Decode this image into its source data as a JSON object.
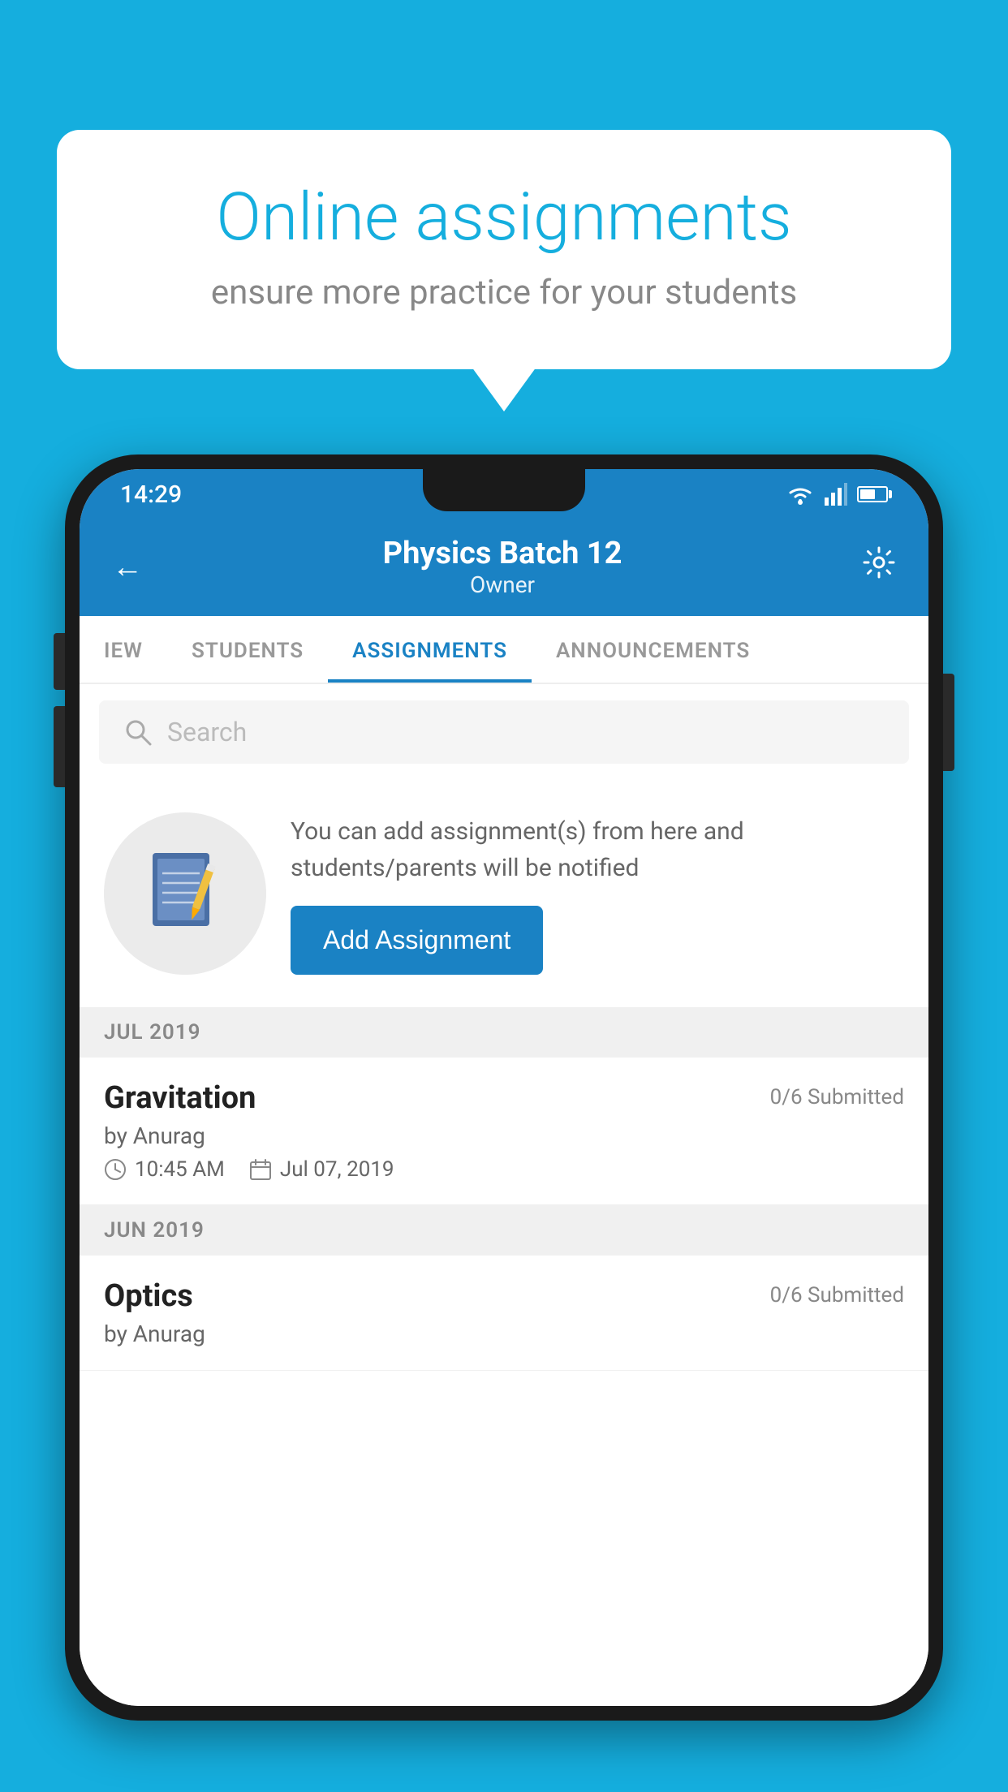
{
  "background_color": "#15AEDE",
  "speech_bubble": {
    "title": "Online assignments",
    "subtitle": "ensure more practice for your students"
  },
  "phone": {
    "status_bar": {
      "time": "14:29"
    },
    "header": {
      "title": "Physics Batch 12",
      "subtitle": "Owner",
      "back_label": "←",
      "settings_label": "⚙"
    },
    "tabs": [
      {
        "label": "IEW",
        "active": false
      },
      {
        "label": "STUDENTS",
        "active": false
      },
      {
        "label": "ASSIGNMENTS",
        "active": true
      },
      {
        "label": "ANNOUNCEMENTS",
        "active": false
      }
    ],
    "search": {
      "placeholder": "Search"
    },
    "add_assignment": {
      "description": "You can add assignment(s) from here and students/parents will be notified",
      "button_label": "Add Assignment"
    },
    "sections": [
      {
        "header": "JUL 2019",
        "items": [
          {
            "name": "Gravitation",
            "submitted": "0/6 Submitted",
            "by": "by Anurag",
            "time": "10:45 AM",
            "date": "Jul 07, 2019"
          }
        ]
      },
      {
        "header": "JUN 2019",
        "items": [
          {
            "name": "Optics",
            "submitted": "0/6 Submitted",
            "by": "by Anurag",
            "time": "",
            "date": ""
          }
        ]
      }
    ]
  }
}
